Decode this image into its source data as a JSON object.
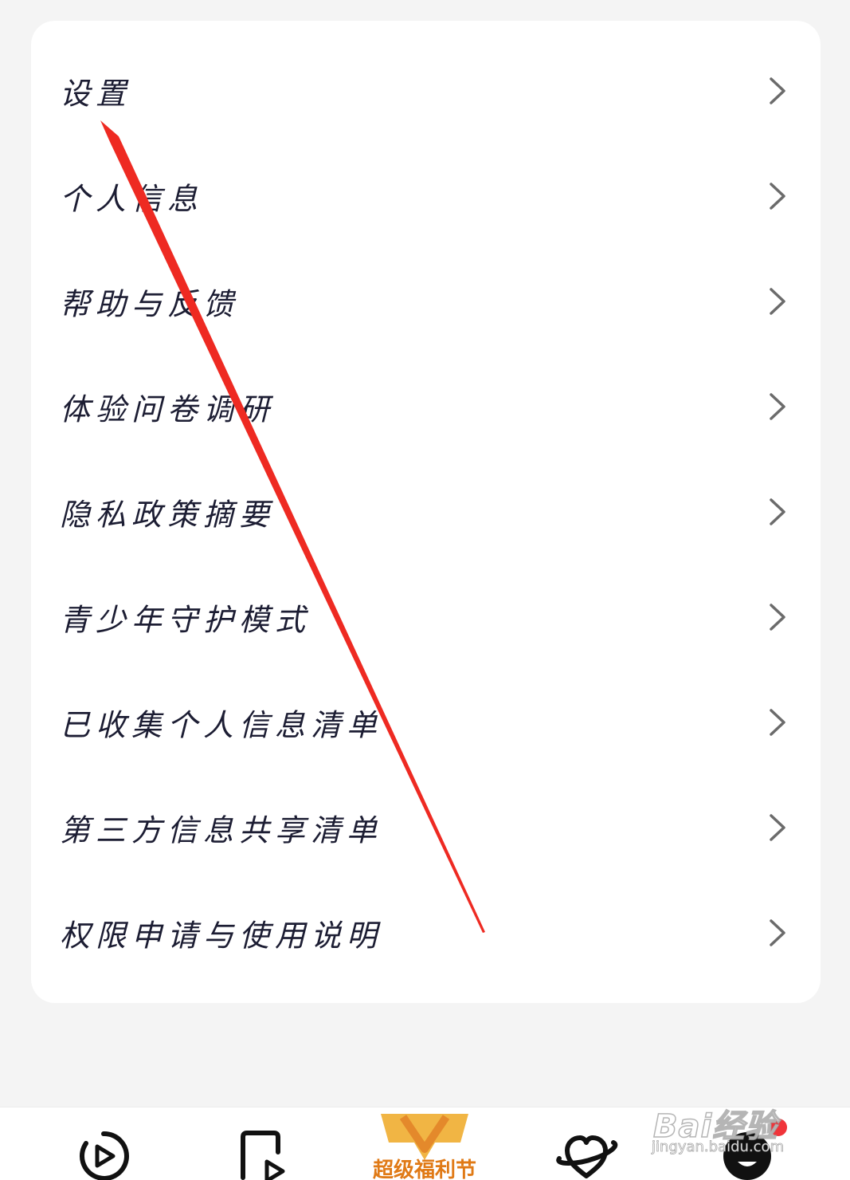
{
  "menu": {
    "items": [
      {
        "label": "设置"
      },
      {
        "label": "个人信息"
      },
      {
        "label": "帮助与反馈"
      },
      {
        "label": "体验问卷调研"
      },
      {
        "label": "隐私政策摘要"
      },
      {
        "label": "青少年守护模式"
      },
      {
        "label": "已收集个人信息清单"
      },
      {
        "label": "第三方信息共享清单"
      },
      {
        "label": "权限申请与使用说明"
      }
    ]
  },
  "bottom_nav": {
    "items": [
      {
        "icon": "play-circle-icon"
      },
      {
        "icon": "video-page-icon"
      },
      {
        "promo_label": "超级福利节"
      },
      {
        "icon": "planet-heart-icon"
      },
      {
        "icon": "profile-avatar-icon"
      }
    ]
  },
  "watermark": {
    "brand": "Bai经验",
    "url": "jingyan.baidu.com"
  },
  "colors": {
    "background": "#f4f4f4",
    "card": "#ffffff",
    "text": "#1c1d33",
    "chevron": "#6b6b6b",
    "annotation_arrow": "#ee2a22",
    "promo": "#e07a16",
    "badge": "#f0343a"
  }
}
